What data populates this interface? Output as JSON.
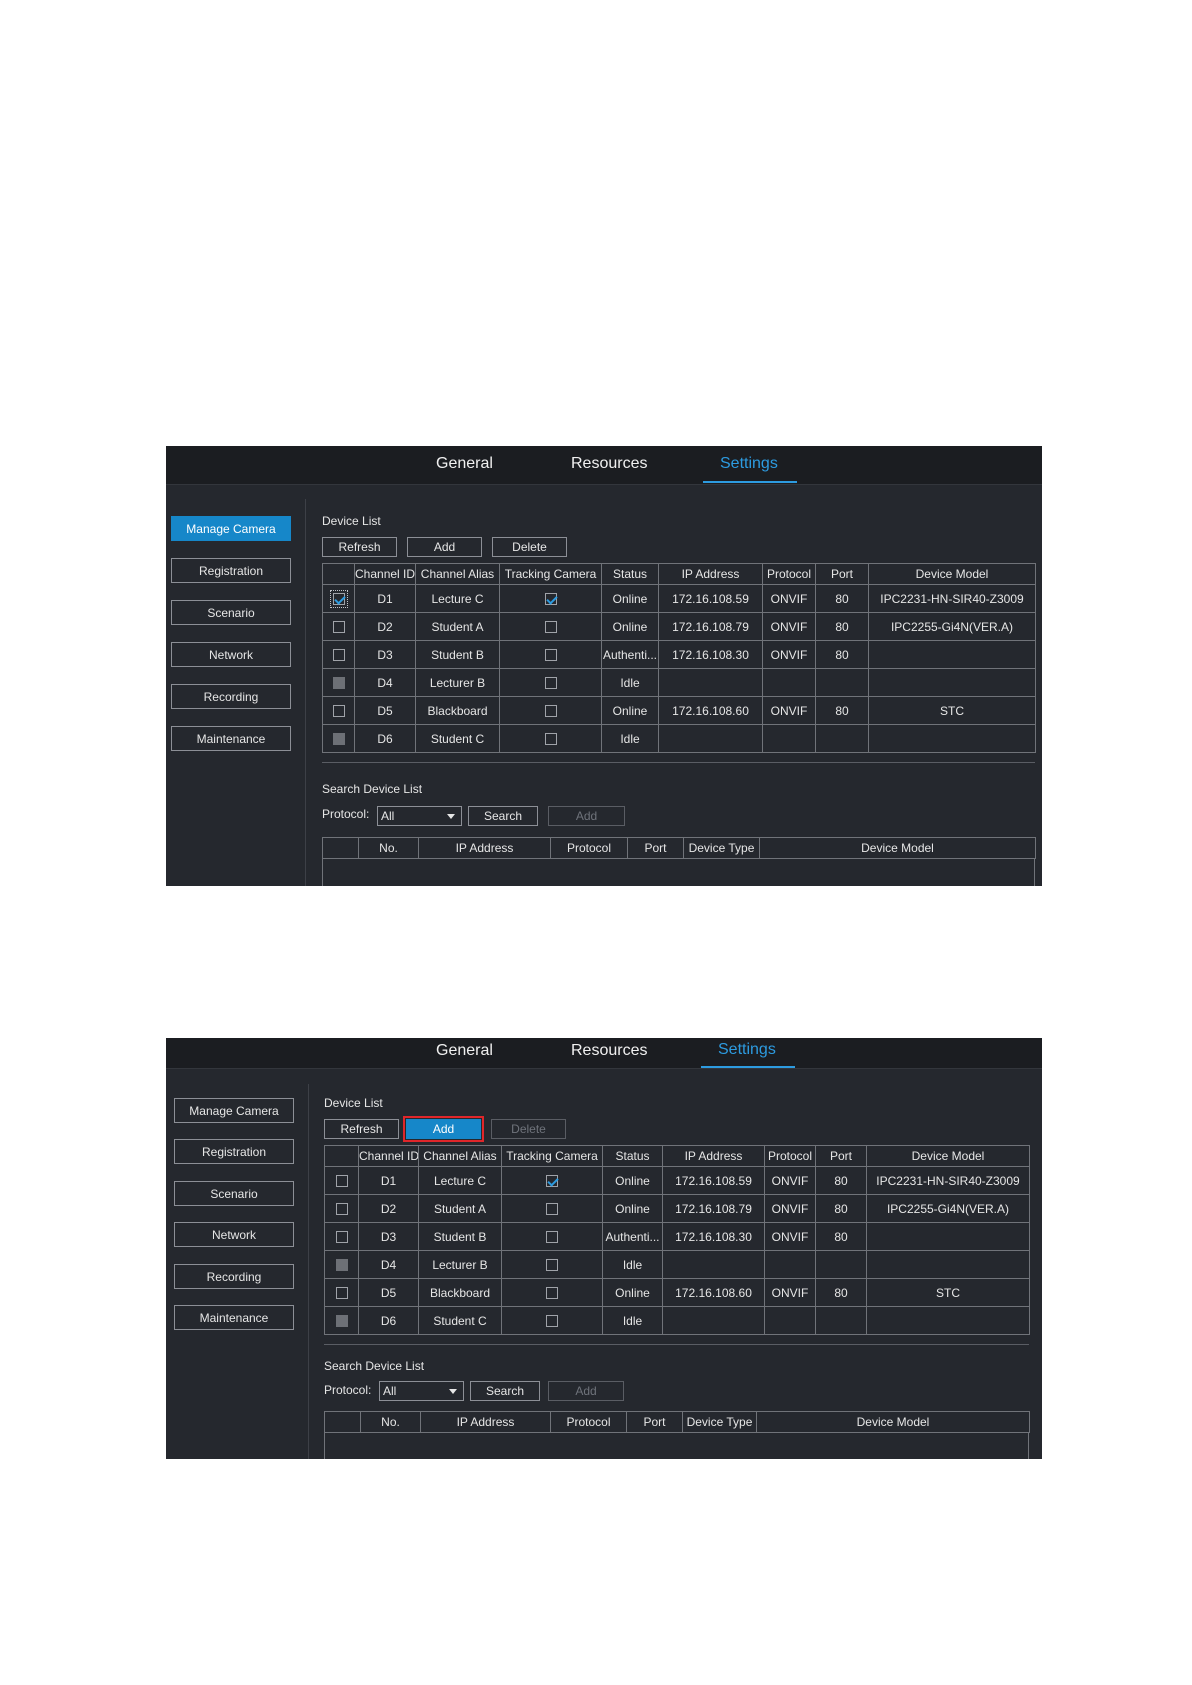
{
  "tabs": [
    "General",
    "Resources",
    "Settings"
  ],
  "active_tab": "Settings",
  "sidebar": [
    "Manage Camera",
    "Registration",
    "Scenario",
    "Network",
    "Recording",
    "Maintenance"
  ],
  "device_list": {
    "title": "Device List",
    "buttons": {
      "refresh": "Refresh",
      "add": "Add",
      "delete": "Delete"
    },
    "columns": [
      "",
      "Channel ID",
      "Channel Alias",
      "Tracking Camera",
      "Status",
      "IP Address",
      "Protocol",
      "Port",
      "Device Model"
    ],
    "rows": [
      {
        "id": "D1",
        "alias": "Lecture C",
        "tracking": true,
        "status": "Online",
        "ip": "172.16.108.59",
        "protocol": "ONVIF",
        "port": "80",
        "model": "IPC2231-HN-SIR40-Z3009"
      },
      {
        "id": "D2",
        "alias": "Student A",
        "tracking": false,
        "status": "Online",
        "ip": "172.16.108.79",
        "protocol": "ONVIF",
        "port": "80",
        "model": "IPC2255-Gi4N(VER.A)"
      },
      {
        "id": "D3",
        "alias": "Student B",
        "tracking": false,
        "status": "Authenti...",
        "ip": "172.16.108.30",
        "protocol": "ONVIF",
        "port": "80",
        "model": ""
      },
      {
        "id": "D4",
        "alias": "Lecturer B",
        "tracking": false,
        "status": "Idle",
        "ip": "",
        "protocol": "",
        "port": "",
        "model": ""
      },
      {
        "id": "D5",
        "alias": "Blackboard",
        "tracking": false,
        "status": "Online",
        "ip": "172.16.108.60",
        "protocol": "ONVIF",
        "port": "80",
        "model": "STC"
      },
      {
        "id": "D6",
        "alias": "Student C",
        "tracking": false,
        "status": "Idle",
        "ip": "",
        "protocol": "",
        "port": "",
        "model": ""
      }
    ]
  },
  "search_list": {
    "title": "Search Device List",
    "protocol_label": "Protocol:",
    "protocol_value": "All",
    "buttons": {
      "search": "Search",
      "add": "Add"
    },
    "columns": [
      "",
      "No.",
      "IP Address",
      "Protocol",
      "Port",
      "Device Type",
      "Device Model"
    ]
  },
  "screenshots": [
    {
      "sidebar_selected": "Manage Camera",
      "row_checked": [
        true,
        false,
        false,
        false,
        false,
        false
      ],
      "row_greyed": [
        false,
        false,
        false,
        true,
        false,
        true
      ],
      "delete_enabled": true,
      "add_highlighted": false
    },
    {
      "sidebar_selected": "",
      "row_checked": [
        false,
        false,
        false,
        false,
        false,
        false
      ],
      "row_greyed": [
        false,
        false,
        false,
        true,
        false,
        true
      ],
      "delete_enabled": false,
      "add_highlighted": true
    }
  ],
  "colors": {
    "accent": "#2d9be0",
    "button_blue": "#1687c9",
    "panel": "#25282e",
    "highlight_box": "#e0262a"
  }
}
